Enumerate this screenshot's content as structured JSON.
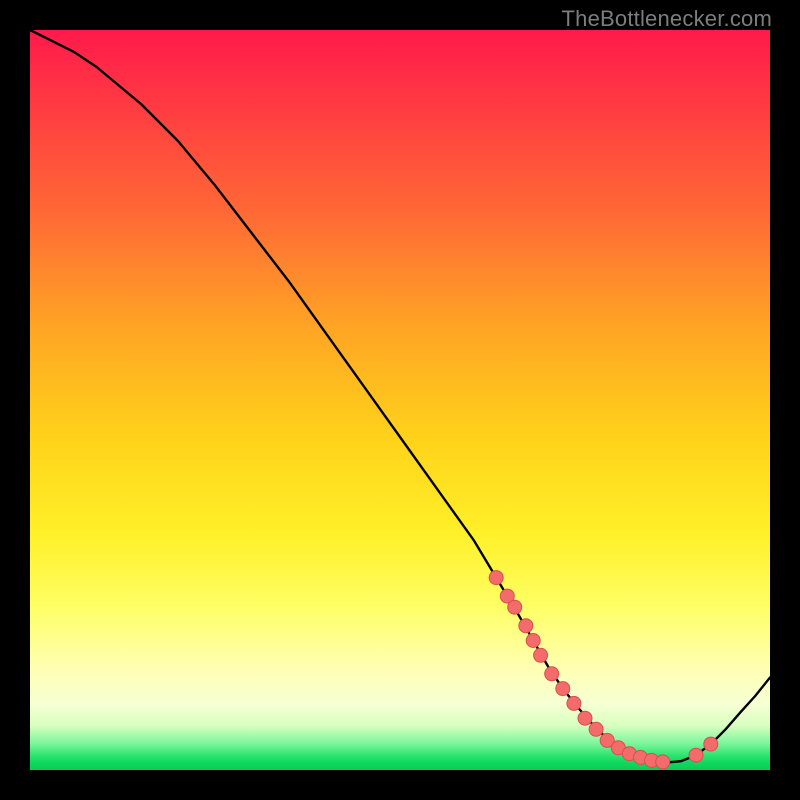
{
  "attribution": "TheBottlenecker.com",
  "colors": {
    "curve_stroke": "#000000",
    "marker_fill": "#f36b6b",
    "marker_stroke": "#d94f4f",
    "frame": "#000000"
  },
  "chart_data": {
    "type": "line",
    "title": "",
    "xlabel": "",
    "ylabel": "",
    "xlim": [
      0,
      100
    ],
    "ylim": [
      0,
      100
    ],
    "x": [
      0,
      3,
      6,
      9,
      12,
      15,
      20,
      25,
      30,
      35,
      40,
      45,
      50,
      55,
      60,
      63,
      66,
      68,
      70,
      72,
      74,
      76,
      78,
      80,
      82,
      84,
      86,
      88,
      90,
      92,
      94,
      96,
      98,
      100
    ],
    "values": [
      100,
      98.5,
      97,
      95,
      92.5,
      90,
      85,
      79,
      72.5,
      66,
      59,
      52,
      45,
      38,
      31,
      26,
      21,
      17.5,
      14,
      11,
      8.5,
      6.2,
      4.2,
      2.8,
      1.8,
      1.2,
      1,
      1.2,
      2,
      3.5,
      5.5,
      7.8,
      10,
      12.5
    ],
    "markers": {
      "x": [
        63,
        64.5,
        65.5,
        67,
        68,
        69,
        70.5,
        72,
        73.5,
        75,
        76.5,
        78,
        79.5,
        81,
        82.5,
        84,
        85.5,
        90,
        92
      ],
      "y": [
        26,
        23.5,
        22,
        19.5,
        17.5,
        15.5,
        13,
        11,
        9,
        7,
        5.5,
        4,
        3,
        2.2,
        1.7,
        1.3,
        1.1,
        2,
        3.5
      ]
    }
  }
}
